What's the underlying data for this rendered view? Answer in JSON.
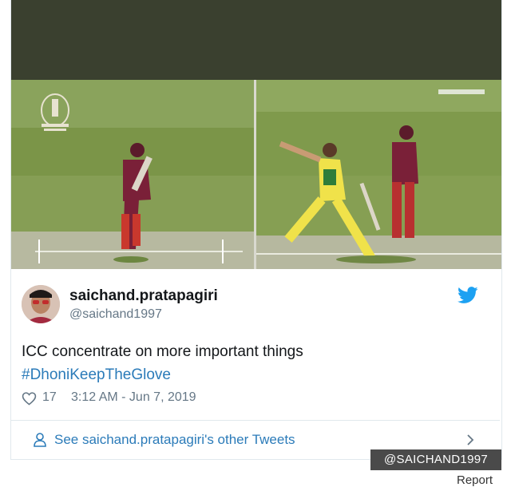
{
  "tweet": {
    "display_name": "saichand.pratapagiri",
    "handle": "@saichand1997",
    "text_line1": "ICC concentrate on more important things",
    "hashtag": "#DhoniKeepTheGlove",
    "like_count": "17",
    "timestamp": "3:12 AM - Jun 7, 2019",
    "see_more": "See saichand.pratapagiri's other Tweets"
  },
  "media": {
    "left_image": "cricket-batsman-with-world-cup-logo",
    "right_image": "cricket-bowler-delivering-ball"
  },
  "icons": {
    "bird": "twitter-bird-icon",
    "heart": "heart-icon",
    "person": "person-icon",
    "chevron": "chevron-right-icon"
  },
  "overlay": {
    "credit": "@SAICHAND1997",
    "report": "Report"
  },
  "colors": {
    "twitter_blue": "#1da1f2",
    "link_blue": "#2b7bb9",
    "top_band": "#3a402f"
  }
}
